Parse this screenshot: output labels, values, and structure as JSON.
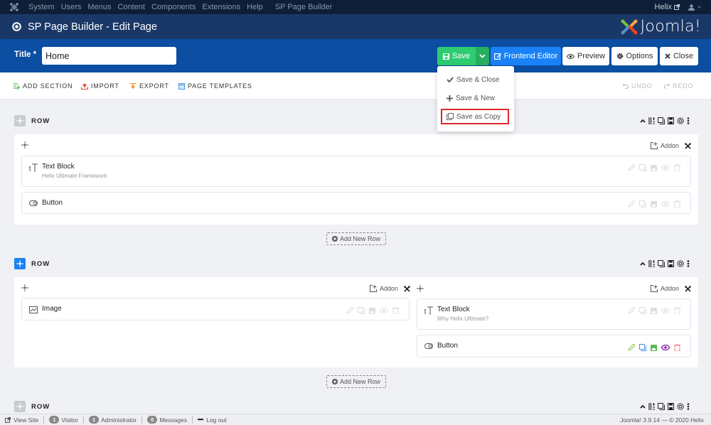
{
  "topnav": {
    "menu": [
      "System",
      "Users",
      "Menus",
      "Content",
      "Components",
      "Extensions",
      "Help"
    ],
    "extra_menu": "SP Page Builder",
    "site_link": "Helix"
  },
  "header": {
    "title": "SP Page Builder - Edit Page",
    "brand": "Joomla!"
  },
  "titlebar": {
    "label": "Title *",
    "value": "Home"
  },
  "actions": {
    "save": "Save",
    "frontend_editor": "Frontend Editor",
    "preview": "Preview",
    "options": "Options",
    "close": "Close"
  },
  "save_dropdown": {
    "items": [
      "Save & Close",
      "Save & New",
      "Save as Copy"
    ],
    "highlighted": "Save as Copy"
  },
  "toolbar": {
    "add_section": "ADD SECTION",
    "import": "IMPORT",
    "export": "EXPORT",
    "page_templates": "PAGE TEMPLATES",
    "undo": "UNDO",
    "redo": "REDO"
  },
  "rows": [
    {
      "label": "ROW",
      "active": false,
      "columns": [
        {
          "addon_label": "Addon",
          "addons": [
            {
              "type": "text-block",
              "name": "Text Block",
              "subtitle": "Helix Ultimate Framework"
            },
            {
              "type": "button",
              "name": "Button",
              "subtitle": ""
            }
          ]
        }
      ],
      "add_new_row": "Add New Row"
    },
    {
      "label": "ROW",
      "active": true,
      "columns": [
        {
          "addon_label": "Addon",
          "addons": [
            {
              "type": "image",
              "name": "Image",
              "subtitle": ""
            }
          ]
        },
        {
          "addon_label": "Addon",
          "addons": [
            {
              "type": "text-block",
              "name": "Text Block",
              "subtitle": "Why Helix Ultimate?"
            },
            {
              "type": "button",
              "name": "Button",
              "subtitle": "",
              "hovered": true
            }
          ]
        }
      ],
      "add_new_row": "Add New Row"
    },
    {
      "label": "ROW",
      "active": false
    }
  ],
  "statusbar": {
    "view_site": "View Site",
    "visitors_count": "1",
    "visitors_label": "Visitor",
    "admins_count": "1",
    "admins_label": "Administrator",
    "messages_count": "0",
    "messages_label": "Messages",
    "logout": "Log out",
    "version": "Joomla! 3.9.14 — © 2020 Helix"
  },
  "colors": {
    "save_green": "#2ecc71",
    "frontend_blue": "#1a82f6",
    "titlebar_blue": "#0b4ea2",
    "header_navy": "#1a3867",
    "highlight_red": "#e02828"
  }
}
